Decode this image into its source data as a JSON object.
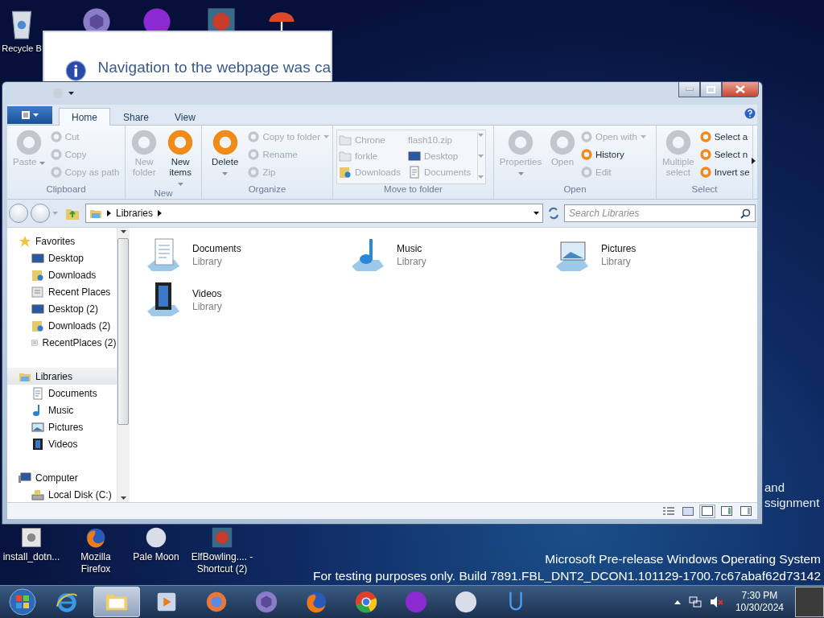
{
  "desktop": {
    "top_icons": [
      {
        "kind": "recycle",
        "label": "Recycle B"
      },
      {
        "kind": "hexagon"
      },
      {
        "kind": "purple"
      },
      {
        "kind": "game"
      },
      {
        "kind": "umbrella"
      }
    ],
    "bottom_icons": [
      {
        "kind": "installer",
        "label": "install_dotn..."
      },
      {
        "kind": "firefox",
        "label": "Mozilla Firefox"
      },
      {
        "kind": "moon",
        "label": "Pale Moon"
      },
      {
        "kind": "game",
        "label": "ElfBowling.... - Shortcut (2)"
      }
    ],
    "background_text": [
      "and",
      "ssignment"
    ],
    "build_notice": [
      "Microsoft Pre-release Windows Operating System",
      "For testing purposes only. Build 7891.FBL_DNT2_DCON1.101129-1700.7c67abaf62d73142"
    ]
  },
  "dialog": {
    "message": "Navigation to the webpage was ca"
  },
  "explorer": {
    "tabs": [
      {
        "label": "Home",
        "selected": true
      },
      {
        "label": "Share",
        "selected": false
      },
      {
        "label": "View",
        "selected": false
      }
    ],
    "ribbon": [
      {
        "label": "Clipboard",
        "items": [
          {
            "kind": "large",
            "label": "Paste",
            "disabled": true,
            "dropdown": true
          },
          {
            "kind": "small",
            "label": "Cut",
            "disabled": true
          },
          {
            "kind": "small",
            "label": "Copy",
            "disabled": true
          },
          {
            "kind": "small",
            "label": "Copy as path",
            "disabled": true
          }
        ]
      },
      {
        "label": "New",
        "items": [
          {
            "kind": "large",
            "label": "New folder",
            "disabled": true
          },
          {
            "kind": "large",
            "label": "New items",
            "disabled": false,
            "dropdown": true
          }
        ]
      },
      {
        "label": "Organize",
        "items": [
          {
            "kind": "large",
            "label": "Delete",
            "disabled": false,
            "dropdown": true
          },
          {
            "kind": "small",
            "label": "Copy to folder",
            "disabled": true,
            "dropdown": true
          },
          {
            "kind": "small",
            "label": "Rename",
            "disabled": true
          },
          {
            "kind": "small",
            "label": "Zip",
            "disabled": true
          }
        ]
      },
      {
        "label": "Move to folder",
        "gallery": [
          {
            "kind": "folder",
            "label": "Chrone"
          },
          {
            "kind": "plain",
            "label": "flash10.zip"
          },
          {
            "kind": "folder",
            "label": "forkle"
          },
          {
            "kind": "desktop",
            "label": "Desktop"
          },
          {
            "kind": "download",
            "label": "Downloads"
          },
          {
            "kind": "document",
            "label": "Documents"
          }
        ]
      },
      {
        "label": "Open",
        "items": [
          {
            "kind": "large",
            "label": "Properties",
            "disabled": true,
            "dropdown": true
          },
          {
            "kind": "large",
            "label": "Open",
            "disabled": true
          },
          {
            "kind": "small",
            "label": "Open with",
            "disabled": true,
            "dropdown": true
          },
          {
            "kind": "small",
            "label": "History",
            "disabled": false
          },
          {
            "kind": "small",
            "label": "Edit",
            "disabled": true
          }
        ]
      },
      {
        "label": "Select",
        "items": [
          {
            "kind": "large",
            "label": "Multiple select",
            "disabled": true
          },
          {
            "kind": "small",
            "label": "Select a",
            "disabled": false
          },
          {
            "kind": "small",
            "label": "Select n",
            "disabled": false
          },
          {
            "kind": "small",
            "label": "Invert se",
            "disabled": false
          }
        ]
      }
    ],
    "address": [
      "Libraries"
    ],
    "search": {
      "placeholder": "Search Libraries"
    },
    "nav": [
      {
        "kind": "star",
        "label": "Favorites",
        "selected": false,
        "children": [
          {
            "kind": "desktop",
            "label": "Desktop",
            "selected": false
          },
          {
            "kind": "download",
            "label": "Downloads",
            "selected": false
          },
          {
            "kind": "recent",
            "label": "Recent Places",
            "selected": false
          },
          {
            "kind": "desktop",
            "label": "Desktop (2)",
            "selected": false
          },
          {
            "kind": "download",
            "label": "Downloads (2)",
            "selected": false
          },
          {
            "kind": "recent",
            "label": "RecentPlaces (2)",
            "selected": false
          }
        ]
      },
      {
        "kind": "library",
        "label": "Libraries",
        "selected": true,
        "children": [
          {
            "kind": "document",
            "label": "Documents",
            "selected": false
          },
          {
            "kind": "music",
            "label": "Music",
            "selected": false
          },
          {
            "kind": "picture",
            "label": "Pictures",
            "selected": false
          },
          {
            "kind": "video",
            "label": "Videos",
            "selected": false
          }
        ]
      },
      {
        "kind": "computer",
        "label": "Computer",
        "selected": false,
        "children": [
          {
            "kind": "disk",
            "label": "Local Disk (C:)",
            "selected": false
          }
        ]
      }
    ],
    "items": [
      {
        "kind": "document",
        "name": "Documents",
        "type": "Library"
      },
      {
        "kind": "music",
        "name": "Music",
        "type": "Library"
      },
      {
        "kind": "picture",
        "name": "Pictures",
        "type": "Library"
      },
      {
        "kind": "video",
        "name": "Videos",
        "type": "Library"
      }
    ]
  },
  "taskbar": {
    "apps": [
      {
        "kind": "ie",
        "selected": false
      },
      {
        "kind": "explorer",
        "selected": true
      },
      {
        "kind": "media",
        "selected": false
      },
      {
        "kind": "swirl",
        "selected": false
      },
      {
        "kind": "hexagon",
        "selected": false
      },
      {
        "kind": "firefox",
        "selected": false
      },
      {
        "kind": "chrome",
        "selected": false
      },
      {
        "kind": "purple",
        "selected": false
      },
      {
        "kind": "moon",
        "selected": false
      },
      {
        "kind": "u",
        "selected": false
      }
    ],
    "time": "7:30 PM",
    "date": "10/30/2024"
  }
}
